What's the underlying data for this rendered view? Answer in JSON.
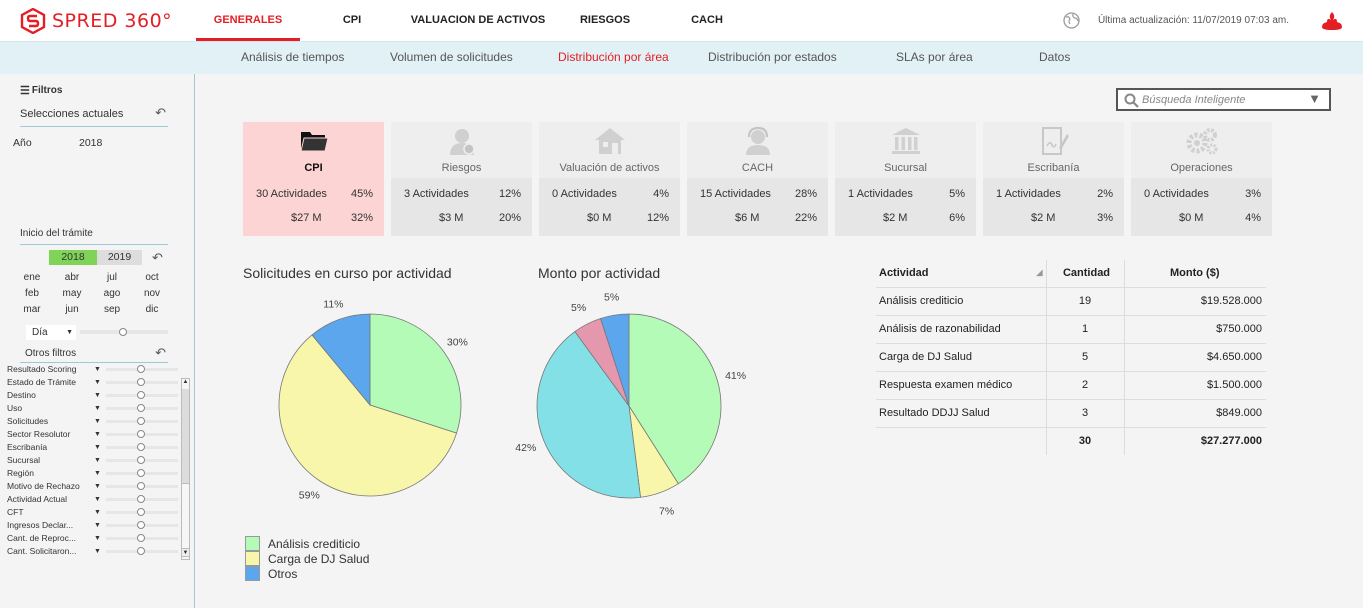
{
  "app": {
    "name": "SPRED 360°",
    "brand_color": "#e31e24"
  },
  "main_tabs": [
    {
      "label": "GENERALES",
      "active": true
    },
    {
      "label": "CPI"
    },
    {
      "label": "VALUACION DE ACTIVOS"
    },
    {
      "label": "RIESGOS"
    },
    {
      "label": "CACH"
    }
  ],
  "header": {
    "last_update": "Última actualización: 11/07/2019 07:03 am.",
    "globe_icon": "globe-icon",
    "bank_logo": "santander-flame-logo"
  },
  "sub_tabs": [
    {
      "label": "Análisis de tiempos"
    },
    {
      "label": "Volumen de solicitudes"
    },
    {
      "label": "Distribución por área",
      "active": true
    },
    {
      "label": "Distribución por estados"
    },
    {
      "label": "SLAs por área"
    },
    {
      "label": "Datos"
    }
  ],
  "sidebar": {
    "filters_title": "Filtros",
    "current_selections": "Selecciones actuales",
    "year_label": "Año",
    "year_value": "2018",
    "inicio_title": "Inicio del trámite",
    "years": [
      "2018",
      "2019"
    ],
    "months": [
      "ene",
      "abr",
      "jul",
      "oct",
      "feb",
      "may",
      "ago",
      "nov",
      "mar",
      "jun",
      "sep",
      "dic"
    ],
    "granularity": "Día",
    "other_filters_title": "Otros filtros",
    "other_filters": [
      "Resultado Scoring",
      "Estado de Trámite",
      "Destino",
      "Uso",
      "Solicitudes",
      "Sector Resolutor",
      "Escribanía",
      "Sucursal",
      "Región",
      "Motivo de Rechazo",
      "Actividad Actual",
      "CFT",
      "Ingresos Declar...",
      "Cant. de Reproc...",
      "Cant. Solicitaron..."
    ]
  },
  "search": {
    "placeholder": "Búsqueda Inteligente"
  },
  "cards": [
    {
      "name": "CPI",
      "icon": "folder-icon",
      "count": "30 Actividades",
      "count_pct": "45%",
      "amount": "$27 M",
      "amount_pct": "32%",
      "active": true
    },
    {
      "name": "Riesgos",
      "icon": "user-icon",
      "count": "3 Actividades",
      "count_pct": "12%",
      "amount": "$3 M",
      "amount_pct": "20%"
    },
    {
      "name": "Valuación de activos",
      "icon": "house-icon",
      "count": "0 Actividades",
      "count_pct": "4%",
      "amount": "$0 M",
      "amount_pct": "12%"
    },
    {
      "name": "CACH",
      "icon": "headset-user-icon",
      "count": "15 Actividades",
      "count_pct": "28%",
      "amount": "$6 M",
      "amount_pct": "22%"
    },
    {
      "name": "Sucursal",
      "icon": "bank-building-icon",
      "count": "1 Actividades",
      "count_pct": "5%",
      "amount": "$2 M",
      "amount_pct": "6%"
    },
    {
      "name": "Escribanía",
      "icon": "document-sign-icon",
      "count": "1 Actividades",
      "count_pct": "2%",
      "amount": "$2 M",
      "amount_pct": "3%"
    },
    {
      "name": "Operaciones",
      "icon": "gears-icon",
      "count": "0 Actividades",
      "count_pct": "3%",
      "amount": "$0 M",
      "amount_pct": "4%"
    }
  ],
  "chart_data": [
    {
      "type": "pie",
      "title": "Solicitudes en curso por actividad",
      "slices": [
        {
          "name": "Análisis crediticio",
          "value": 30,
          "label": "30%",
          "color": "#b3fbb6"
        },
        {
          "name": "Carga de DJ Salud",
          "value": 59,
          "label": "59%",
          "color": "#f8f6aa"
        },
        {
          "name": "Otros",
          "value": 11,
          "label": "11%",
          "color": "#5ca6ee"
        }
      ]
    },
    {
      "type": "pie",
      "title": "Monto por actividad",
      "slices": [
        {
          "name": "Análisis crediticio",
          "value": 41,
          "label": "41%",
          "color": "#b3fbb6"
        },
        {
          "name": "Carga de DJ Salud",
          "value": 7,
          "label": "7%",
          "color": "#f8f6aa"
        },
        {
          "name": "",
          "value": 42,
          "label": "42%",
          "color": "#82e0e6"
        },
        {
          "name": "",
          "value": 5,
          "label": "5%",
          "color": "#e497ad"
        },
        {
          "name": "Otros",
          "value": 5,
          "label": "5%",
          "color": "#5ca6ee"
        }
      ]
    }
  ],
  "legend": [
    {
      "label": "Análisis crediticio",
      "color": "#b3fbb6"
    },
    {
      "label": "Carga de DJ Salud",
      "color": "#f8f6aa"
    },
    {
      "label": "Otros",
      "color": "#5ca6ee"
    }
  ],
  "table": {
    "headers": [
      "Actividad",
      "Cantidad",
      "Monto ($)"
    ],
    "rows": [
      [
        "Análisis crediticio",
        "19",
        "$19.528.000"
      ],
      [
        "Análisis de razonabilidad",
        "1",
        "$750.000"
      ],
      [
        "Carga de DJ Salud",
        "5",
        "$4.650.000"
      ],
      [
        "Respuesta examen médico",
        "2",
        "$1.500.000"
      ],
      [
        "Resultado DDJJ Salud",
        "3",
        "$849.000"
      ]
    ],
    "total": [
      "",
      "30",
      "$27.277.000"
    ]
  }
}
